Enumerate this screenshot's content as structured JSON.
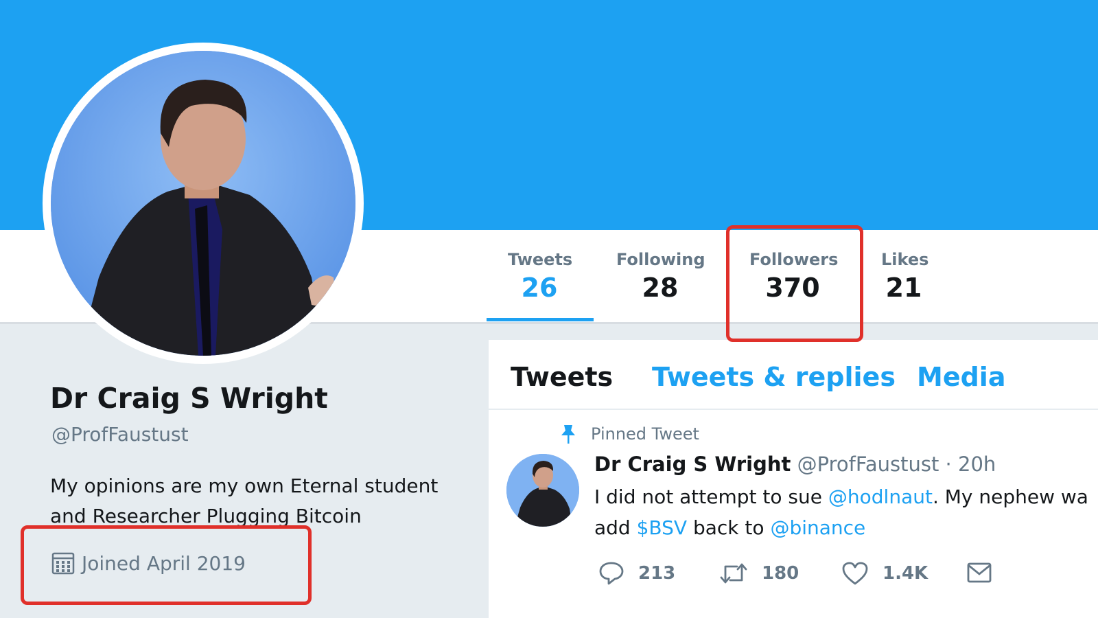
{
  "stats": {
    "tweets": {
      "label": "Tweets",
      "value": "26"
    },
    "following": {
      "label": "Following",
      "value": "28"
    },
    "followers": {
      "label": "Followers",
      "value": "370"
    },
    "likes": {
      "label": "Likes",
      "value": "21"
    }
  },
  "profile": {
    "name": "Dr Craig S Wright",
    "handle": "@ProfFaustust",
    "bio_line1": "My opinions are my own Eternal student",
    "bio_line2": "and Researcher Plugging Bitcoin",
    "joined": "Joined April 2019"
  },
  "tabs": [
    "Tweets",
    "Tweets & replies",
    "Media"
  ],
  "tweet": {
    "pinned_label": "Pinned Tweet",
    "author": "Dr Craig S Wright",
    "handle_time": "@ProfFaustust · 20h",
    "line1_a": "I did not attempt to sue ",
    "mention1": "@hodlnaut",
    "line1_b": ". My nephew wa",
    "line2_a": "add ",
    "cashtag": "$BSV",
    "line2_b": " back to ",
    "mention2": "@binance",
    "replies": "213",
    "retweets": "180",
    "likes": "1.4K"
  },
  "colors": {
    "brand": "#1da1f2",
    "highlight": "#e0302a"
  }
}
